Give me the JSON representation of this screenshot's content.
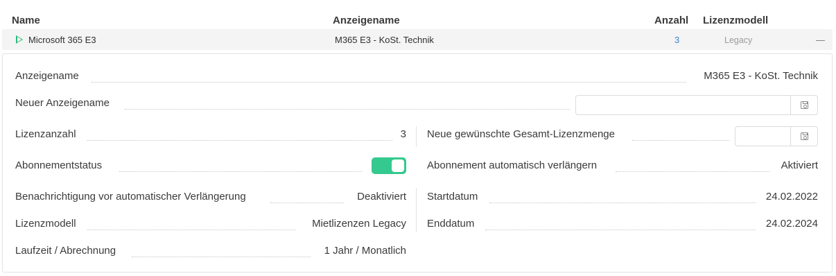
{
  "table": {
    "headers": {
      "name": "Name",
      "display_name": "Anzeigename",
      "count": "Anzahl",
      "license_model": "Lizenzmodell"
    },
    "row": {
      "name": "Microsoft 365 E3",
      "display_name": "M365 E3 - KoSt. Technik",
      "count": "3",
      "license_model": "Legacy",
      "collapse_symbol": "—"
    }
  },
  "details": {
    "display_name": {
      "label": "Anzeigename",
      "value": "M365 E3 - KoSt. Technik"
    },
    "new_display_name": {
      "label": "Neuer Anzeigename",
      "value": "",
      "placeholder": ""
    },
    "license_count": {
      "label": "Lizenzanzahl",
      "value": "3"
    },
    "desired_total": {
      "label": "Neue gewünschte Gesamt-Lizenzmenge",
      "value": "",
      "placeholder": ""
    },
    "subscription_status": {
      "label": "Abonnementstatus",
      "toggle_on": true
    },
    "auto_renew": {
      "label": "Abonnement automatisch verlängern",
      "value": "Aktiviert"
    },
    "renewal_notice": {
      "label": "Benachrichtigung vor automatischer Verlängerung",
      "value": "Deaktiviert"
    },
    "start_date": {
      "label": "Startdatum",
      "value": "24.02.2022"
    },
    "license_model": {
      "label": "Lizenzmodell",
      "value": "Mietlizenzen Legacy"
    },
    "end_date": {
      "label": "Enddatum",
      "value": "24.02.2024"
    },
    "term_billing": {
      "label": "Laufzeit / Abrechnung",
      "value": "1 Jahr / Monatlich"
    }
  },
  "icons": {
    "expand": "play-triangle-icon",
    "save": "save-icon"
  },
  "colors": {
    "accent_green": "#34c98e",
    "link_blue": "#3a7fd5"
  }
}
